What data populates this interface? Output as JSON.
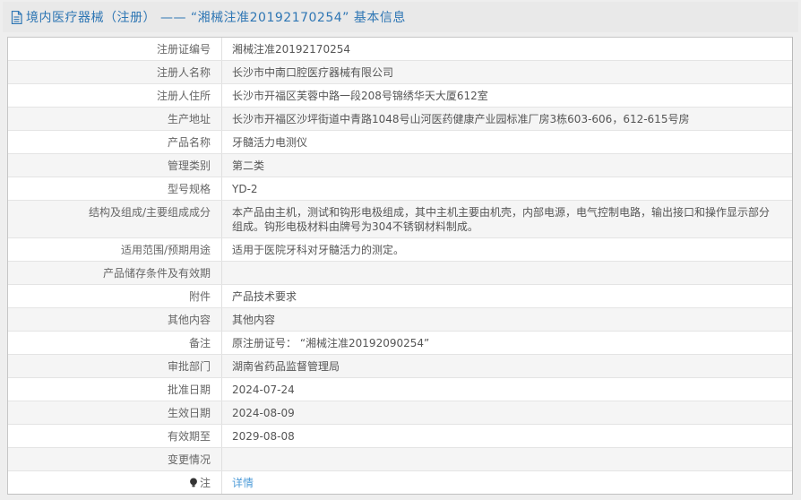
{
  "colors": {
    "accent_blue": "#2e76b4",
    "link_blue": "#4f9cd8",
    "row_alt_bg": "#f5f5f5",
    "header_bg": "#e9e9e9"
  },
  "header": {
    "icon": "document-icon",
    "title": "境内医疗器械（注册） —— “湘械注准20192170254” 基本信息"
  },
  "table": {
    "rows": [
      {
        "label": "注册证编号",
        "value": "湘械注准20192170254"
      },
      {
        "label": "注册人名称",
        "value": "长沙市中南口腔医疗器械有限公司"
      },
      {
        "label": "注册人住所",
        "value": "长沙市开福区芙蓉中路一段208号锦绣华天大厦612室"
      },
      {
        "label": "生产地址",
        "value": "长沙市开福区沙坪街道中青路1048号山河医药健康产业园标准厂房3栋603-606，612-615号房"
      },
      {
        "label": "产品名称",
        "value": "牙髓活力电测仪"
      },
      {
        "label": "管理类别",
        "value": "第二类"
      },
      {
        "label": "型号规格",
        "value": "YD-2"
      },
      {
        "label": "结构及组成/主要组成成分",
        "value": "本产品由主机，测试和钩形电极组成，其中主机主要由机壳，内部电源，电气控制电路，输出接口和操作显示部分组成。钩形电极材料由牌号为304不锈钢材料制成。"
      },
      {
        "label": "适用范围/预期用途",
        "value": "适用于医院牙科对牙髓活力的测定。"
      },
      {
        "label": "产品储存条件及有效期",
        "value": ""
      },
      {
        "label": "附件",
        "value": "产品技术要求"
      },
      {
        "label": "其他内容",
        "value": "其他内容"
      },
      {
        "label": "备注",
        "value": "原注册证号： “湘械注准20192090254”"
      },
      {
        "label": "审批部门",
        "value": "湖南省药品监督管理局"
      },
      {
        "label": "批准日期",
        "value": "2024-07-24"
      },
      {
        "label": "生效日期",
        "value": "2024-08-09"
      },
      {
        "label": "有效期至",
        "value": "2029-08-08"
      },
      {
        "label": "变更情况",
        "value": ""
      },
      {
        "label": "注",
        "label_icon": "note-bulb-icon",
        "value": "详情",
        "value_is_link": true
      }
    ]
  }
}
